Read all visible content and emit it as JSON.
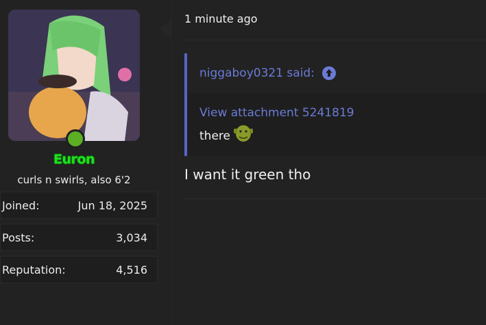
{
  "user": {
    "username": "Euron",
    "title": "curls n swirls, also 6'2",
    "stats": [
      {
        "label": "Joined:",
        "value": "Jun 18, 2025"
      },
      {
        "label": "Posts:",
        "value": "3,034"
      },
      {
        "label": "Reputation:",
        "value": "4,516"
      }
    ],
    "avatar_icon": "anime-avatar-image",
    "online_color": "#5cae25"
  },
  "post": {
    "timestamp": "1 minute ago",
    "quote": {
      "author": "niggaboy0321 said:",
      "attachment": "View attachment 5241819",
      "text": "there",
      "emoji_icon": "shrek-face-emoji"
    },
    "message": "I want it green tho"
  },
  "colors": {
    "link": "#6c7bd6",
    "quote_border": "#5865c7",
    "username": "#22dd22"
  }
}
